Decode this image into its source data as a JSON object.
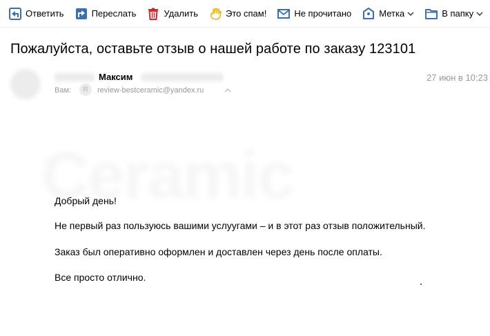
{
  "toolbar": {
    "reply": "Ответить",
    "forward": "Переслать",
    "delete": "Удалить",
    "spam": "Это спам!",
    "unread": "Не прочитано",
    "label": "Метка",
    "folder": "В папку"
  },
  "message": {
    "subject": "Пожалуйста, оставьте отзыв о нашей работе по заказу 123101",
    "sender_name": "Максим",
    "date": "27 июн в 10:23",
    "to_label": "Вам:",
    "to_email": "review-bestceramic@yandex.ru",
    "watermark": "Ceramic"
  },
  "body": {
    "greeting": "Добрый день!",
    "line1": "Не первый раз пользуюсь вашими услуугами – и в этот раз отзыв положительный.",
    "line2": "Заказ был оперативно оформлен и доставлен через день после оплаты.",
    "line3": "Все просто отлично."
  },
  "colors": {
    "icon_blue": "#3a6fb0",
    "delete_red": "#d7262b",
    "spam_yellow": "#f2b705",
    "muted_text": "#999999"
  }
}
